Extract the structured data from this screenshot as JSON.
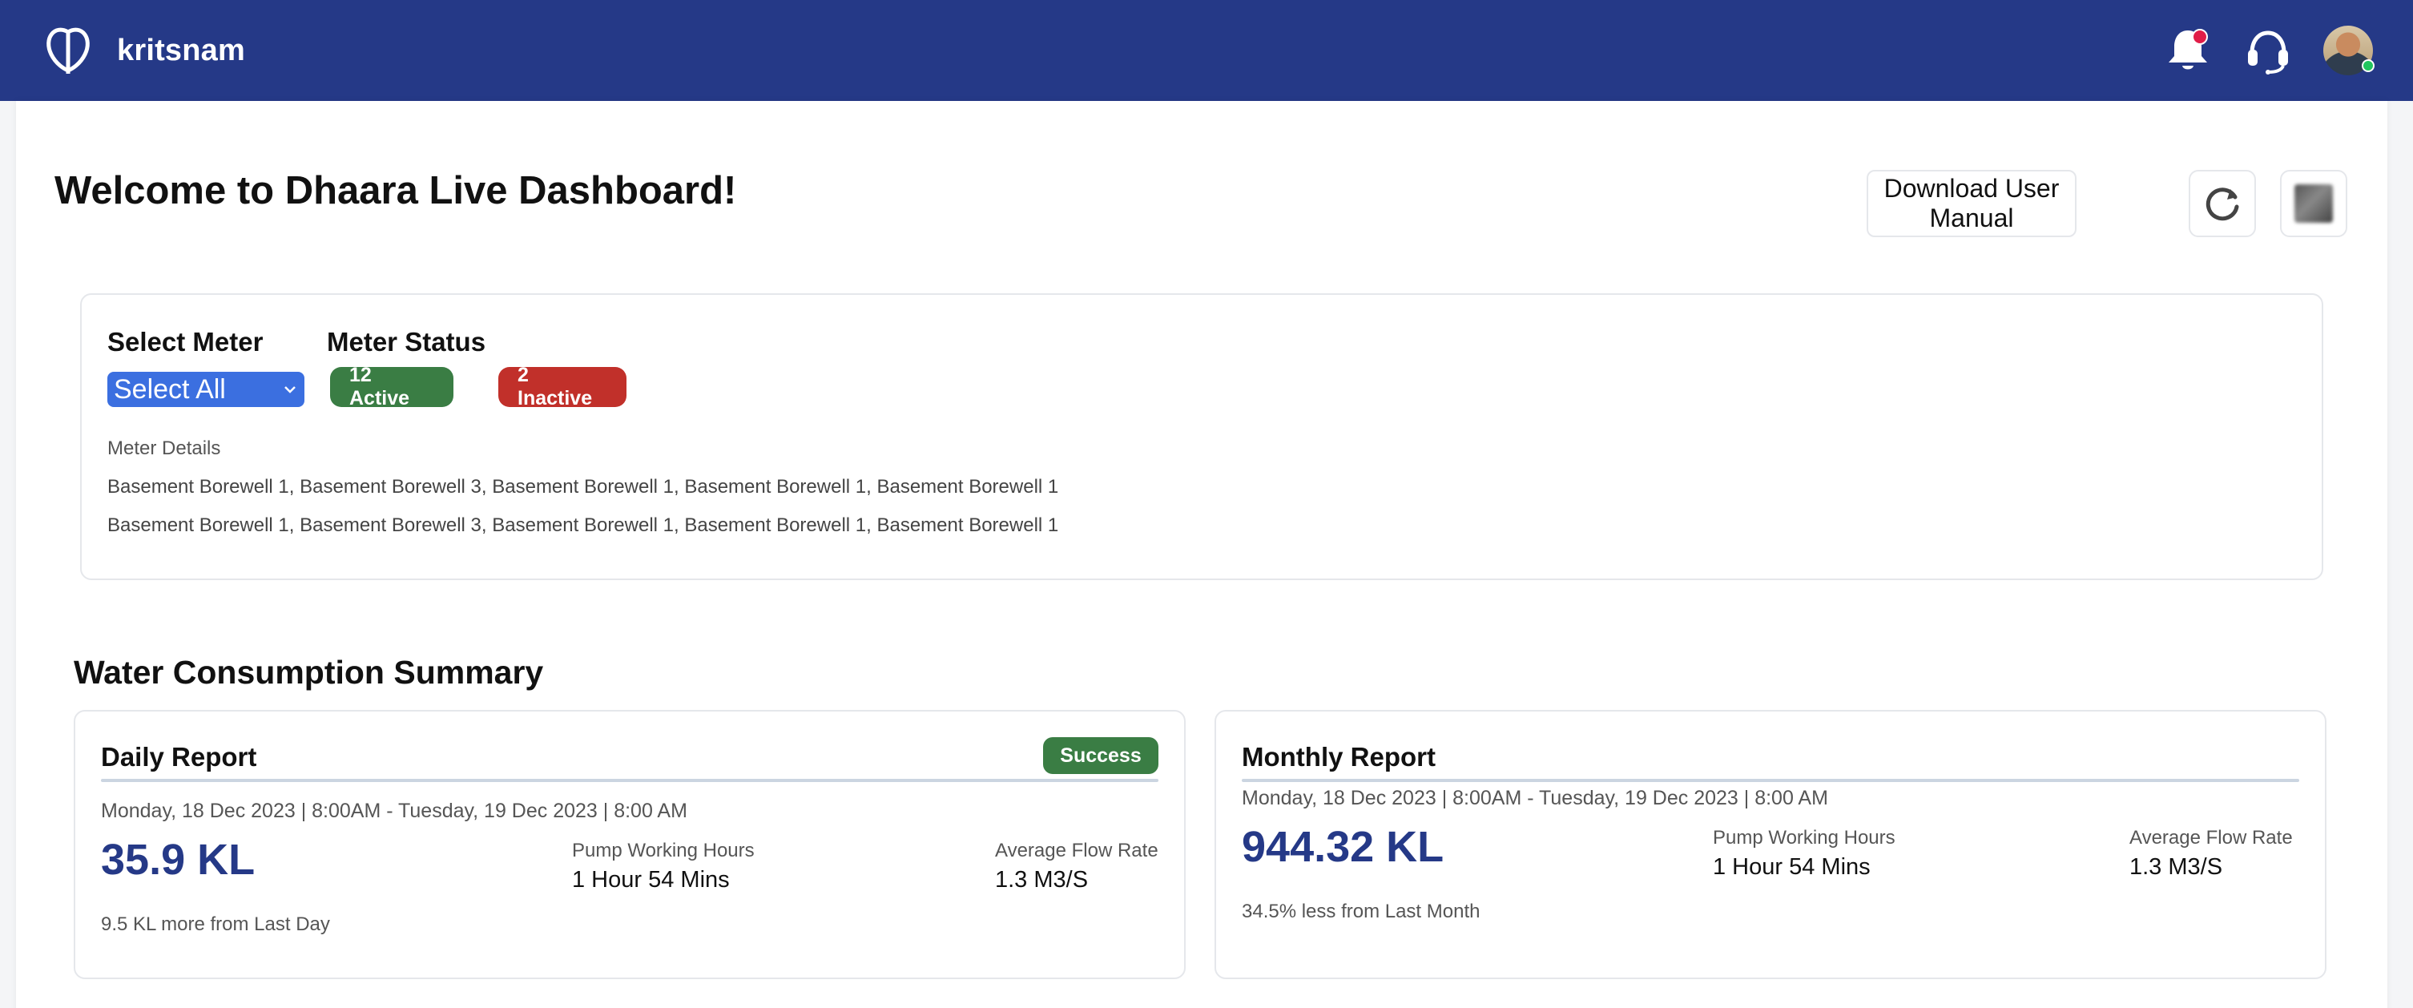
{
  "brand": {
    "name": "kritsnam"
  },
  "topbar": {
    "icons": [
      "notification-bell-icon",
      "headset-support-icon",
      "user-avatar"
    ]
  },
  "page": {
    "title": "Welcome to Dhaara Live Dashboard!",
    "download_manual_label": "Download User Manual"
  },
  "meter": {
    "select_label": "Select Meter",
    "select_value": "Select All",
    "status_label": "Meter Status",
    "active_label": "12 Active",
    "inactive_label": "2 Inactive",
    "details_label": "Meter Details",
    "details_lines": [
      "Basement Borewell 1, Basement Borewell 3, Basement Borewell 1, Basement Borewell 1, Basement Borewell 1",
      "Basement Borewell 1, Basement Borewell 3, Basement Borewell 1, Basement Borewell 1, Basement Borewell 1"
    ]
  },
  "summary": {
    "title": "Water Consumption Summary",
    "daily": {
      "title": "Daily Report",
      "badge": "Success",
      "date_range": "Monday, 18 Dec 2023 | 8:00AM - Tuesday, 19 Dec 2023 | 8:00 AM",
      "value": "35.9 KL",
      "pump_label": "Pump Working Hours",
      "pump_value": "1 Hour 54 Mins",
      "flow_label": "Average Flow Rate",
      "flow_value": "1.3 M3/S",
      "note": "9.5 KL more from Last Day"
    },
    "monthly": {
      "title": "Monthly Report",
      "date_range": "Monday, 18 Dec 2023 | 8:00AM - Tuesday, 19 Dec 2023 | 8:00 AM",
      "value": "944.32 KL",
      "pump_label": "Pump Working Hours",
      "pump_value": "1 Hour 54 Mins",
      "flow_label": "Average Flow Rate",
      "flow_value": "1.3 M3/S",
      "note": "34.5% less from Last Month"
    }
  },
  "colors": {
    "topbar": "#253987",
    "active": "#3a7d44",
    "inactive": "#c1302a",
    "value_accent": "#253987",
    "select_bg": "#3b6fe0"
  }
}
